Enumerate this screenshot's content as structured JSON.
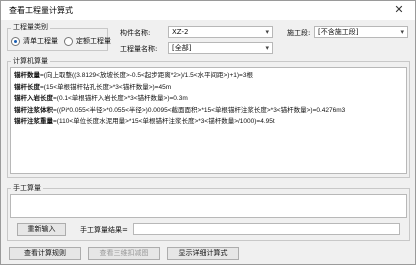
{
  "window": {
    "title": "查看工程量计算式",
    "close_icon": "close-icon"
  },
  "qty_type": {
    "group_label": "工程量类别",
    "options": [
      {
        "label": "清单工程量",
        "selected": true
      },
      {
        "label": "定额工程量",
        "selected": false
      }
    ]
  },
  "filters": {
    "component_name_label": "构件名称:",
    "component_name_value": "XZ-2",
    "stage_label": "施工段:",
    "stage_value": "[不含施工段]",
    "qty_name_label": "工程量名称:",
    "qty_name_value": "[全部]"
  },
  "calc_section": {
    "label": "计算机算量",
    "lines": [
      {
        "name": "锚杆数量",
        "expr": "=(向上取整((3.8129<放坡长度>-0.5<起步距离*2>)/1.5<水平间距>)+1)=3根"
      },
      {
        "name": "锚杆长度",
        "expr": "=(15<单根锚杆钻孔长度>*3<锚杆数量>)=45m"
      },
      {
        "name": "锚杆入岩长度",
        "expr": "=(0.1<单根锚杆入岩长度>*3<锚杆数量>)=0.3m"
      },
      {
        "name": "锚杆注浆体积",
        "expr": "=((Pi*0.055<半径>*0.055<半径>)0.0095<截面面积>*15<单根锚杆注浆长度>*3<锚杆数量>)=0.4276m3"
      },
      {
        "name": "锚杆注浆重量",
        "expr": "=(110<单位长度水泥用量>*15<单根锚杆注浆长度>*3<锚杆数量>/1000)=4.95t"
      }
    ]
  },
  "manual_section": {
    "label": "手工算量"
  },
  "bottom": {
    "reinput_label": "重新输入",
    "manual_result_label": "手工算量结果=",
    "manual_result_value": ""
  },
  "footer": {
    "view_rules_label": "查看计算规则",
    "view_3d_label": "查看三维扣减图",
    "show_details_label": "显示详细计算式"
  }
}
